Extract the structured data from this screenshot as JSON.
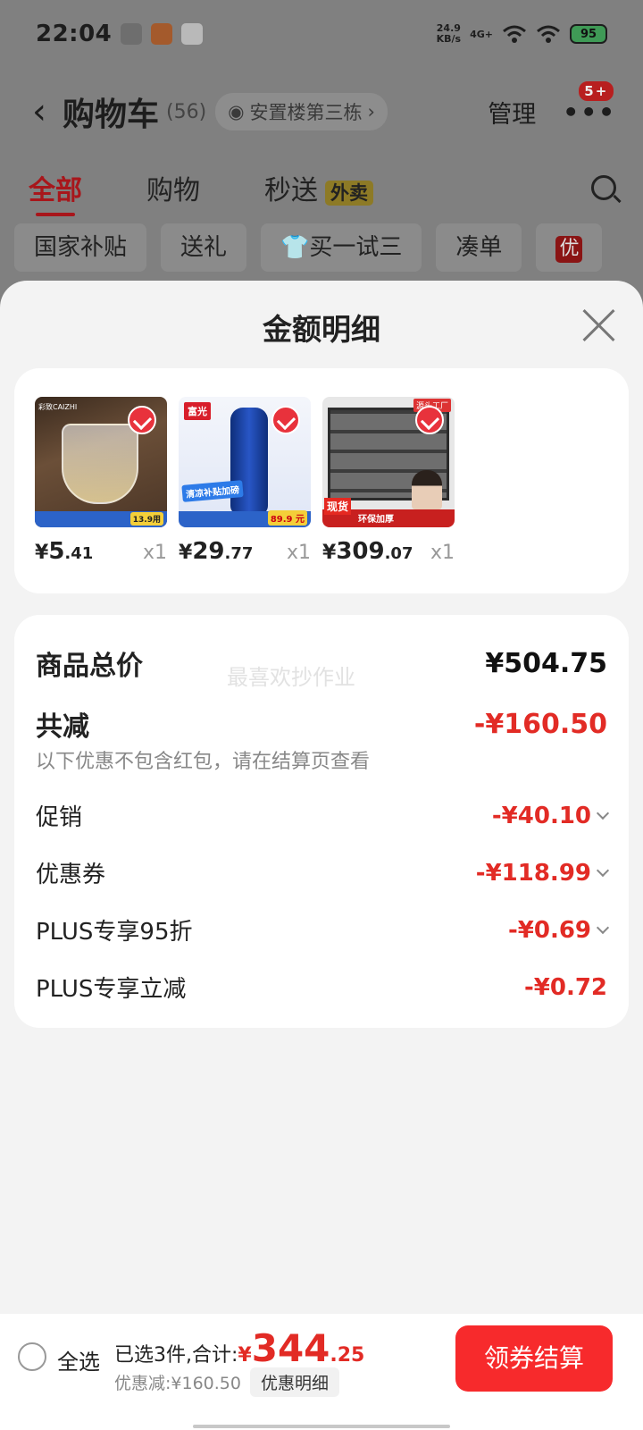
{
  "status_bar": {
    "time": "22:04",
    "net_speed_value": "24.9",
    "net_speed_unit": "KB/s",
    "network": "4G+",
    "battery": "95"
  },
  "header": {
    "back_icon": "chevron-left-icon",
    "title": "购物车",
    "count": "(56)",
    "address": "安置楼第三栋",
    "manage": "管理",
    "more_badge": "5+"
  },
  "tabs": [
    {
      "label": "全部",
      "active": true
    },
    {
      "label": "购物"
    },
    {
      "label": "秒送",
      "badge": "外卖"
    }
  ],
  "chips": [
    "国家补贴",
    "送礼",
    "买一试三",
    "凑单",
    "优"
  ],
  "sheet": {
    "title": "金额明细",
    "watermark": "最喜欢抄作业",
    "products": [
      {
        "brand": "彩致CAIZHI",
        "price_symbol": "¥",
        "price_int": "5",
        "price_dec": ".41",
        "qty": "x1",
        "thumb_price": "13.9用"
      },
      {
        "brand": "富光",
        "ribbon": "清凉补贴加磅",
        "price_symbol": "¥",
        "price_int": "29",
        "price_dec": ".77",
        "qty": "x1",
        "thumb_price": "89.9 元"
      },
      {
        "brand": "源头工厂",
        "tag_xh": "现货",
        "tag_hb": "环保加厚",
        "price_symbol": "¥",
        "price_int": "309",
        "price_dec": ".07",
        "qty": "x1"
      }
    ],
    "summary": {
      "total_label": "商品总价",
      "total_value": "¥504.75",
      "reduce_label": "共减",
      "reduce_value": "-¥160.50",
      "note": "以下优惠不包含红包，请在结算页查看",
      "rows": [
        {
          "label": "促销",
          "value": "-¥40.10"
        },
        {
          "label": "优惠券",
          "value": "-¥118.99"
        },
        {
          "label": "PLUS专享95折",
          "value": "-¥0.69"
        },
        {
          "label": "PLUS专享立减",
          "value": "-¥0.72"
        }
      ]
    }
  },
  "bottom": {
    "select_all": "全选",
    "selected_text": "已选3件,合计:",
    "yen": "¥",
    "amount_int": "344",
    "amount_dec": ".25",
    "discount_text": "优惠减:¥160.50",
    "detail_button": "优惠明细",
    "checkout": "领券结算"
  }
}
